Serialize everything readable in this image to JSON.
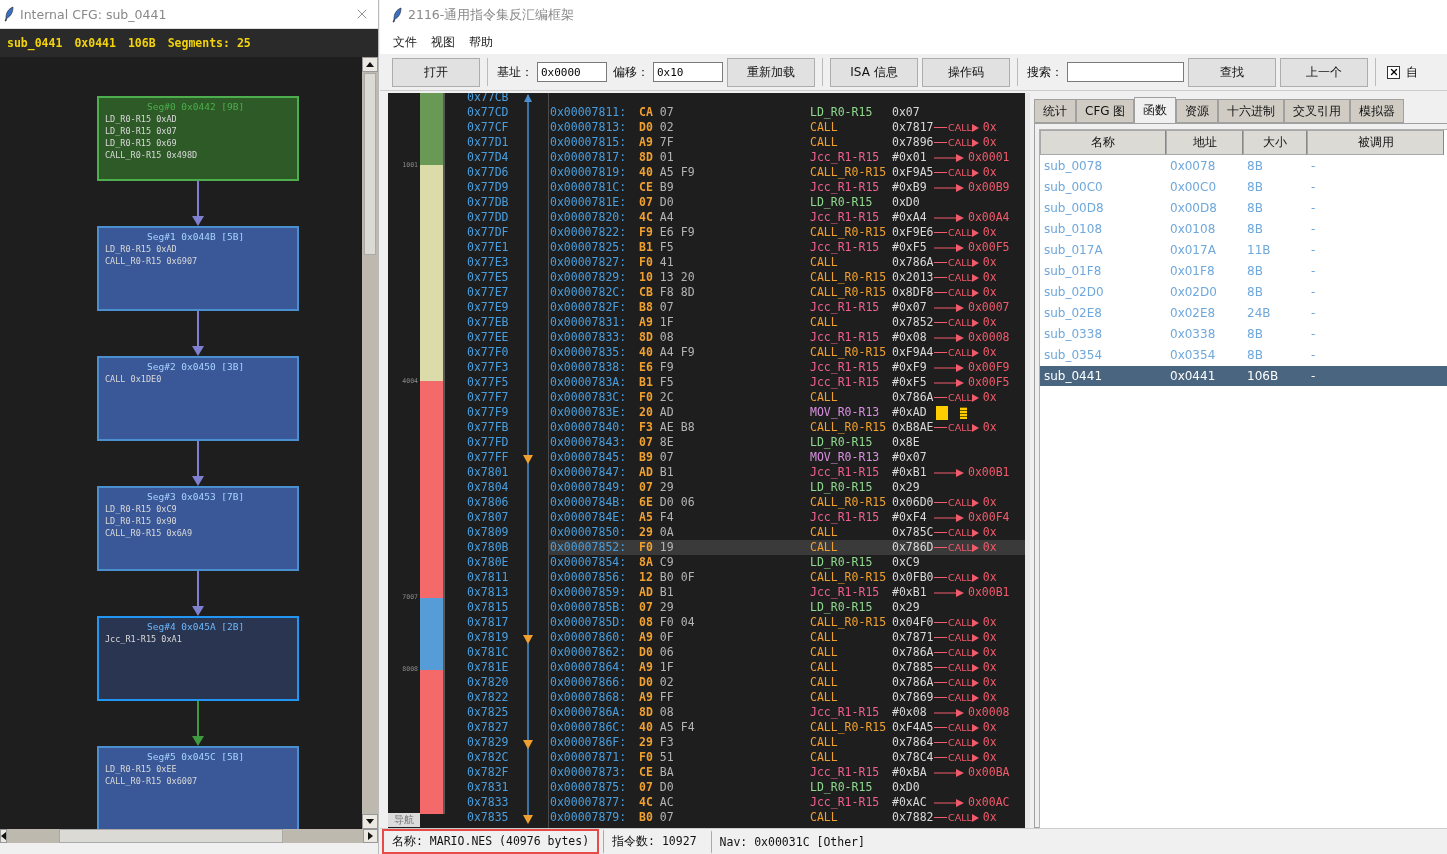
{
  "cfg_window": {
    "title": "Internal CFG: sub_0441",
    "header": [
      "sub_0441",
      "0x0441",
      "106B",
      "Segments: 25"
    ],
    "nodes": [
      {
        "kind": "entry",
        "title": "Seg#0 0x0442 [9B]",
        "lines": [
          "LD_R0-R15 0xAD",
          "LD_R0-R15 0x07",
          "LD_R0-R15 0x69",
          "CALL_R0-R15 0x498D"
        ]
      },
      {
        "kind": "block",
        "title": "Seg#1 0x044B [5B]",
        "lines": [
          "LD_R0-R15 0xAD",
          "CALL_R0-R15 0x6907"
        ]
      },
      {
        "kind": "block",
        "title": "Seg#2 0x0450 [3B]",
        "lines": [
          "CALL 0x1DE0"
        ]
      },
      {
        "kind": "block",
        "title": "Seg#3 0x0453 [7B]",
        "lines": [
          "LD_R0-R15 0xC9",
          "LD_R0-R15 0x90",
          "CALL_R0-R15 0x6A9"
        ]
      },
      {
        "kind": "branch",
        "title": "Seg#4 0x045A [2B]",
        "lines": [
          "Jcc_R1-R15 0xA1"
        ]
      },
      {
        "kind": "block",
        "title": "Seg#5 0x045C [5B]",
        "lines": [
          "LD_R0-R15 0xEE",
          "CALL_R0-R15 0x6007"
        ]
      }
    ],
    "edges": [
      {
        "color": "#8080d0"
      },
      {
        "color": "#8080d0"
      },
      {
        "color": "#8080d0"
      },
      {
        "color": "#8080d0"
      },
      {
        "color": "#3f9a3f"
      }
    ]
  },
  "main_window": {
    "title": "2116-通用指令集反汇编框架",
    "menu": [
      "文件",
      "视图",
      "帮助"
    ],
    "toolbar": [
      {
        "kind": "button",
        "label": "打开"
      },
      {
        "kind": "separator"
      },
      {
        "kind": "field",
        "label": "基址：",
        "value": "0x0000"
      },
      {
        "kind": "field",
        "label": "偏移：",
        "value": "0x10"
      },
      {
        "kind": "button",
        "label": "重新加载"
      },
      {
        "kind": "separator"
      },
      {
        "kind": "button",
        "label": "ISA 信息"
      },
      {
        "kind": "button",
        "label": "操作码"
      },
      {
        "kind": "separator"
      },
      {
        "kind": "search",
        "label": "搜索："
      },
      {
        "kind": "button",
        "label": "查找"
      },
      {
        "kind": "button",
        "label": "上一个"
      },
      {
        "kind": "separator"
      },
      {
        "kind": "checkbox",
        "label": "自",
        "checked": true
      }
    ],
    "nav_map": {
      "label": "导航",
      "segments": [
        {
          "color": "#6a9955",
          "tick": "1001"
        },
        {
          "color": "#dcdcaa",
          "tick": "4004"
        },
        {
          "color": "#f46a6a",
          "tick": "7007"
        },
        {
          "color": "#569cd6",
          "tick": "8008"
        },
        {
          "color": "#f46a6a"
        }
      ]
    },
    "addresses": [
      "0x77CB",
      "0x77CD",
      "0x77CF",
      "0x77D1",
      "0x77D4",
      "0x77D6",
      "0x77D9",
      "0x77DB",
      "0x77DD",
      "0x77DF",
      "0x77E1",
      "0x77E3",
      "0x77E5",
      "0x77E7",
      "0x77E9",
      "0x77EB",
      "0x77EE",
      "0x77F0",
      "0x77F3",
      "0x77F5",
      "0x77F7",
      "0x77F9",
      "0x77FB",
      "0x77FD",
      "0x77FF",
      "0x7801",
      "0x7804",
      "0x7806",
      "0x7807",
      "0x7809",
      "0x780B",
      "0x780E",
      "0x7811",
      "0x7813",
      "0x7815",
      "0x7817",
      "0x7819",
      "0x781C",
      "0x781E",
      "0x7820",
      "0x7822",
      "0x7825",
      "0x7827",
      "0x7829",
      "0x782C",
      "0x782F",
      "0x7831",
      "0x7833",
      "0x7835"
    ],
    "code_rows": [
      {
        "address": "0x00007811:",
        "bytes": [
          "CA",
          "07"
        ],
        "kind": "load",
        "mnemonic": "LD_R0-R15",
        "operand": "0x07",
        "selected": false
      },
      {
        "address": "0x00007813:",
        "bytes": [
          "D0",
          "02"
        ],
        "kind": "call",
        "mnemonic": "CALL",
        "operand": "0x7817",
        "xref": {
          "kind": "call",
          "label": "CALL",
          "target": "0x"
        },
        "selected": false
      },
      {
        "address": "0x00007815:",
        "bytes": [
          "A9",
          "7F"
        ],
        "kind": "call",
        "mnemonic": "CALL",
        "operand": "0x7896",
        "xref": {
          "kind": "call",
          "label": "CALL",
          "target": "0x"
        },
        "selected": false
      },
      {
        "address": "0x00007817:",
        "bytes": [
          "8D",
          "01"
        ],
        "kind": "branch",
        "mnemonic": "Jcc_R1-R15",
        "operand": "#0x01",
        "xref": {
          "kind": "jump",
          "target": "0x0001"
        },
        "selected": false
      },
      {
        "address": "0x00007819:",
        "bytes": [
          "40",
          "A5",
          "F9"
        ],
        "kind": "call",
        "mnemonic": "CALL_R0-R15",
        "operand": "0xF9A5",
        "xref": {
          "kind": "call",
          "label": "CALL",
          "target": "0x"
        },
        "selected": false
      },
      {
        "address": "0x0000781C:",
        "bytes": [
          "CE",
          "B9"
        ],
        "kind": "branch",
        "mnemonic": "Jcc_R1-R15",
        "operand": "#0xB9",
        "xref": {
          "kind": "jump",
          "target": "0x00B9"
        },
        "selected": false
      },
      {
        "address": "0x0000781E:",
        "bytes": [
          "07",
          "D0"
        ],
        "kind": "load",
        "mnemonic": "LD_R0-R15",
        "operand": "0xD0",
        "selected": false
      },
      {
        "address": "0x00007820:",
        "bytes": [
          "4C",
          "A4"
        ],
        "kind": "branch",
        "mnemonic": "Jcc_R1-R15",
        "operand": "#0xA4",
        "xref": {
          "kind": "jump",
          "target": "0x00A4"
        },
        "selected": false
      },
      {
        "address": "0x00007822:",
        "bytes": [
          "F9",
          "E6",
          "F9"
        ],
        "kind": "call",
        "mnemonic": "CALL_R0-R15",
        "operand": "0xF9E6",
        "xref": {
          "kind": "call",
          "label": "CALL",
          "target": "0x"
        },
        "selected": false
      },
      {
        "address": "0x00007825:",
        "bytes": [
          "B1",
          "F5"
        ],
        "kind": "branch",
        "mnemonic": "Jcc_R1-R15",
        "operand": "#0xF5",
        "xref": {
          "kind": "jump",
          "target": "0x00F5"
        },
        "selected": false
      },
      {
        "address": "0x00007827:",
        "bytes": [
          "F0",
          "41"
        ],
        "kind": "call",
        "mnemonic": "CALL",
        "operand": "0x786A",
        "xref": {
          "kind": "call",
          "label": "CALL",
          "target": "0x"
        },
        "selected": false
      },
      {
        "address": "0x00007829:",
        "bytes": [
          "10",
          "13",
          "20"
        ],
        "kind": "call",
        "mnemonic": "CALL_R0-R15",
        "operand": "0x2013",
        "xref": {
          "kind": "call",
          "label": "CALL",
          "target": "0x"
        },
        "selected": false
      },
      {
        "address": "0x0000782C:",
        "bytes": [
          "CB",
          "F8",
          "8D"
        ],
        "kind": "call",
        "mnemonic": "CALL_R0-R15",
        "operand": "0x8DF8",
        "xref": {
          "kind": "call",
          "label": "CALL",
          "target": "0x"
        },
        "selected": false
      },
      {
        "address": "0x0000782F:",
        "bytes": [
          "B8",
          "07"
        ],
        "kind": "branch",
        "mnemonic": "Jcc_R1-R15",
        "operand": "#0x07",
        "xref": {
          "kind": "jump",
          "target": "0x0007"
        },
        "selected": false
      },
      {
        "address": "0x00007831:",
        "bytes": [
          "A9",
          "1F"
        ],
        "kind": "call",
        "mnemonic": "CALL",
        "operand": "0x7852",
        "xref": {
          "kind": "call",
          "label": "CALL",
          "target": "0x"
        },
        "selected": false
      },
      {
        "address": "0x00007833:",
        "bytes": [
          "8D",
          "08"
        ],
        "kind": "branch",
        "mnemonic": "Jcc_R1-R15",
        "operand": "#0x08",
        "xref": {
          "kind": "jump",
          "target": "0x0008"
        },
        "selected": false
      },
      {
        "address": "0x00007835:",
        "bytes": [
          "40",
          "A4",
          "F9"
        ],
        "kind": "call",
        "mnemonic": "CALL_R0-R15",
        "operand": "0xF9A4",
        "xref": {
          "kind": "call",
          "label": "CALL",
          "target": "0x"
        },
        "selected": false
      },
      {
        "address": "0x00007838:",
        "bytes": [
          "E6",
          "F9"
        ],
        "kind": "branch",
        "mnemonic": "Jcc_R1-R15",
        "operand": "#0xF9",
        "xref": {
          "kind": "jump",
          "target": "0x00F9"
        },
        "selected": false
      },
      {
        "address": "0x0000783A:",
        "bytes": [
          "B1",
          "F5"
        ],
        "kind": "branch",
        "mnemonic": "Jcc_R1-R15",
        "operand": "#0xF5",
        "xref": {
          "kind": "jump",
          "target": "0x00F5"
        },
        "selected": false
      },
      {
        "address": "0x0000783C:",
        "bytes": [
          "F0",
          "2C"
        ],
        "kind": "call",
        "mnemonic": "CALL",
        "operand": "0x786A",
        "xref": {
          "kind": "call",
          "label": "CALL",
          "target": "0x"
        },
        "selected": false
      },
      {
        "address": "0x0000783E:",
        "bytes": [
          "20",
          "AD"
        ],
        "kind": "move",
        "mnemonic": "MOV_R0-R13",
        "operand": "#0xAD",
        "marker": true,
        "selected": false
      },
      {
        "address": "0x00007840:",
        "bytes": [
          "F3",
          "AE",
          "B8"
        ],
        "kind": "call",
        "mnemonic": "CALL_R0-R15",
        "operand": "0xB8AE",
        "xref": {
          "kind": "call",
          "label": "CALL",
          "target": "0x"
        },
        "selected": false
      },
      {
        "address": "0x00007843:",
        "bytes": [
          "07",
          "8E"
        ],
        "kind": "load",
        "mnemonic": "LD_R0-R15",
        "operand": "0x8E",
        "selected": false
      },
      {
        "address": "0x00007845:",
        "bytes": [
          "B9",
          "07"
        ],
        "kind": "move",
        "mnemonic": "MOV_R0-R13",
        "operand": "#0x07",
        "selected": false
      },
      {
        "address": "0x00007847:",
        "bytes": [
          "AD",
          "B1"
        ],
        "kind": "branch",
        "mnemonic": "Jcc_R1-R15",
        "operand": "#0xB1",
        "xref": {
          "kind": "jump",
          "target": "0x00B1"
        },
        "selected": false
      },
      {
        "address": "0x00007849:",
        "bytes": [
          "07",
          "29"
        ],
        "kind": "load",
        "mnemonic": "LD_R0-R15",
        "operand": "0x29",
        "selected": false
      },
      {
        "address": "0x0000784B:",
        "bytes": [
          "6E",
          "D0",
          "06"
        ],
        "kind": "call",
        "mnemonic": "CALL_R0-R15",
        "operand": "0x06D0",
        "xref": {
          "kind": "call",
          "label": "CALL",
          "target": "0x"
        },
        "selected": false
      },
      {
        "address": "0x0000784E:",
        "bytes": [
          "A5",
          "F4"
        ],
        "kind": "branch",
        "mnemonic": "Jcc_R1-R15",
        "operand": "#0xF4",
        "xref": {
          "kind": "jump",
          "target": "0x00F4"
        },
        "selected": false
      },
      {
        "address": "0x00007850:",
        "bytes": [
          "29",
          "0A"
        ],
        "kind": "call",
        "mnemonic": "CALL",
        "operand": "0x785C",
        "xref": {
          "kind": "call",
          "label": "CALL",
          "target": "0x"
        },
        "selected": false
      },
      {
        "address": "0x00007852:",
        "bytes": [
          "F0",
          "19"
        ],
        "kind": "call",
        "mnemonic": "CALL",
        "operand": "0x786D",
        "xref": {
          "kind": "call",
          "label": "CALL",
          "target": "0x"
        },
        "selected": true
      },
      {
        "address": "0x00007854:",
        "bytes": [
          "8A",
          "C9"
        ],
        "kind": "load",
        "mnemonic": "LD_R0-R15",
        "operand": "0xC9",
        "selected": false
      },
      {
        "address": "0x00007856:",
        "bytes": [
          "12",
          "B0",
          "0F"
        ],
        "kind": "call",
        "mnemonic": "CALL_R0-R15",
        "operand": "0x0FB0",
        "xref": {
          "kind": "call",
          "label": "CALL",
          "target": "0x"
        },
        "selected": false
      },
      {
        "address": "0x00007859:",
        "bytes": [
          "AD",
          "B1"
        ],
        "kind": "branch",
        "mnemonic": "Jcc_R1-R15",
        "operand": "#0xB1",
        "xref": {
          "kind": "jump",
          "target": "0x00B1"
        },
        "selected": false
      },
      {
        "address": "0x0000785B:",
        "bytes": [
          "07",
          "29"
        ],
        "kind": "load",
        "mnemonic": "LD_R0-R15",
        "operand": "0x29",
        "selected": false
      },
      {
        "address": "0x0000785D:",
        "bytes": [
          "08",
          "F0",
          "04"
        ],
        "kind": "call",
        "mnemonic": "CALL_R0-R15",
        "operand": "0x04F0",
        "xref": {
          "kind": "call",
          "label": "CALL",
          "target": "0x"
        },
        "selected": false
      },
      {
        "address": "0x00007860:",
        "bytes": [
          "A9",
          "0F"
        ],
        "kind": "call",
        "mnemonic": "CALL",
        "operand": "0x7871",
        "xref": {
          "kind": "call",
          "label": "CALL",
          "target": "0x"
        },
        "selected": false
      },
      {
        "address": "0x00007862:",
        "bytes": [
          "D0",
          "06"
        ],
        "kind": "call",
        "mnemonic": "CALL",
        "operand": "0x786A",
        "xref": {
          "kind": "call",
          "label": "CALL",
          "target": "0x"
        },
        "selected": false
      },
      {
        "address": "0x00007864:",
        "bytes": [
          "A9",
          "1F"
        ],
        "kind": "call",
        "mnemonic": "CALL",
        "operand": "0x7885",
        "xref": {
          "kind": "call",
          "label": "CALL",
          "target": "0x"
        },
        "selected": false
      },
      {
        "address": "0x00007866:",
        "bytes": [
          "D0",
          "02"
        ],
        "kind": "call",
        "mnemonic": "CALL",
        "operand": "0x786A",
        "xref": {
          "kind": "call",
          "label": "CALL",
          "target": "0x"
        },
        "selected": false
      },
      {
        "address": "0x00007868:",
        "bytes": [
          "A9",
          "FF"
        ],
        "kind": "call",
        "mnemonic": "CALL",
        "operand": "0x7869",
        "xref": {
          "kind": "call",
          "label": "CALL",
          "target": "0x"
        },
        "selected": false
      },
      {
        "address": "0x0000786A:",
        "bytes": [
          "8D",
          "08"
        ],
        "kind": "branch",
        "mnemonic": "Jcc_R1-R15",
        "operand": "#0x08",
        "xref": {
          "kind": "jump",
          "target": "0x0008"
        },
        "selected": false
      },
      {
        "address": "0x0000786C:",
        "bytes": [
          "40",
          "A5",
          "F4"
        ],
        "kind": "call",
        "mnemonic": "CALL_R0-R15",
        "operand": "0xF4A5",
        "xref": {
          "kind": "call",
          "label": "CALL",
          "target": "0x"
        },
        "selected": false
      },
      {
        "address": "0x0000786F:",
        "bytes": [
          "29",
          "F3"
        ],
        "kind": "call",
        "mnemonic": "CALL",
        "operand": "0x7864",
        "xref": {
          "kind": "call",
          "label": "CALL",
          "target": "0x"
        },
        "selected": false
      },
      {
        "address": "0x00007871:",
        "bytes": [
          "F0",
          "51"
        ],
        "kind": "call",
        "mnemonic": "CALL",
        "operand": "0x78C4",
        "xref": {
          "kind": "call",
          "label": "CALL",
          "target": "0x"
        },
        "selected": false
      },
      {
        "address": "0x00007873:",
        "bytes": [
          "CE",
          "BA"
        ],
        "kind": "branch",
        "mnemonic": "Jcc_R1-R15",
        "operand": "#0xBA",
        "xref": {
          "kind": "jump",
          "target": "0x00BA"
        },
        "selected": false
      },
      {
        "address": "0x00007875:",
        "bytes": [
          "07",
          "D0"
        ],
        "kind": "load",
        "mnemonic": "LD_R0-R15",
        "operand": "0xD0",
        "selected": false
      },
      {
        "address": "0x00007877:",
        "bytes": [
          "4C",
          "AC"
        ],
        "kind": "branch",
        "mnemonic": "Jcc_R1-R15",
        "operand": "#0xAC",
        "xref": {
          "kind": "jump",
          "target": "0x00AC"
        },
        "selected": false
      },
      {
        "address": "0x00007879:",
        "bytes": [
          "B0",
          "07"
        ],
        "kind": "call",
        "mnemonic": "CALL",
        "operand": "0x7882",
        "xref": {
          "kind": "call",
          "label": "CALL",
          "target": "0x"
        },
        "selected": false
      }
    ],
    "tabs": [
      {
        "label": "统计",
        "selected": false
      },
      {
        "label": "CFG 图",
        "selected": false
      },
      {
        "label": "函数",
        "selected": true
      },
      {
        "label": "资源",
        "selected": false
      },
      {
        "label": "十六进制",
        "selected": false
      },
      {
        "label": "交叉引用",
        "selected": false
      },
      {
        "label": "模拟器",
        "selected": false
      }
    ],
    "functions": {
      "columns": [
        "名称",
        "地址",
        "大小",
        "被调用"
      ],
      "rows": [
        {
          "cells": [
            "sub_0078",
            "0x0078",
            "8B",
            "-"
          ],
          "selected": false
        },
        {
          "cells": [
            "sub_00C0",
            "0x00C0",
            "8B",
            "-"
          ],
          "selected": false
        },
        {
          "cells": [
            "sub_00D8",
            "0x00D8",
            "8B",
            "-"
          ],
          "selected": false
        },
        {
          "cells": [
            "sub_0108",
            "0x0108",
            "8B",
            "-"
          ],
          "selected": false
        },
        {
          "cells": [
            "sub_017A",
            "0x017A",
            "11B",
            "-"
          ],
          "selected": false
        },
        {
          "cells": [
            "sub_01F8",
            "0x01F8",
            "8B",
            "-"
          ],
          "selected": false
        },
        {
          "cells": [
            "sub_02D0",
            "0x02D0",
            "8B",
            "-"
          ],
          "selected": false
        },
        {
          "cells": [
            "sub_02E8",
            "0x02E8",
            "24B",
            "-"
          ],
          "selected": false
        },
        {
          "cells": [
            "sub_0338",
            "0x0338",
            "8B",
            "-"
          ],
          "selected": false
        },
        {
          "cells": [
            "sub_0354",
            "0x0354",
            "8B",
            "-"
          ],
          "selected": false
        },
        {
          "cells": [
            "sub_0441",
            "0x0441",
            "106B",
            "-"
          ],
          "selected": true
        }
      ]
    },
    "status_bar": [
      {
        "text": "名称: MARIO.NES (40976 bytes)",
        "outlined": true
      },
      {
        "text": "指令数: 10927",
        "outlined": false
      },
      {
        "text": "Nav: 0x00031C [Other]",
        "outlined": false
      }
    ]
  }
}
